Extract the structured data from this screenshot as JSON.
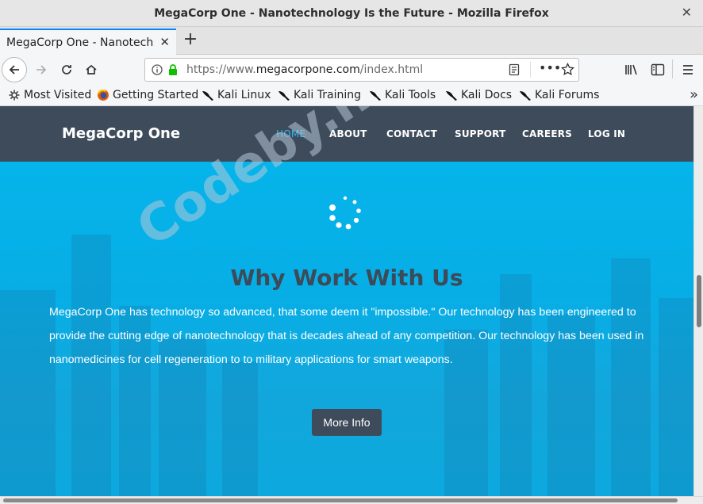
{
  "window": {
    "title": "MegaCorp One - Nanotechnology Is the Future - Mozilla Firefox"
  },
  "tabs": [
    {
      "label": "MegaCorp One - Nanotechnology Is the Future"
    }
  ],
  "urlbar": {
    "prefix": "https://www.",
    "domain": "megacorpone.com",
    "path": "/index.html"
  },
  "bookmarks": [
    {
      "label": "Most Visited",
      "icon": "gear-icon"
    },
    {
      "label": "Getting Started",
      "icon": "firefox-icon"
    },
    {
      "label": "Kali Linux",
      "icon": "kali-dragon-icon"
    },
    {
      "label": "Kali Training",
      "icon": "kali-dragon-icon"
    },
    {
      "label": "Kali Tools",
      "icon": "kali-dragon-icon"
    },
    {
      "label": "Kali Docs",
      "icon": "kali-dragon-icon"
    },
    {
      "label": "Kali Forums",
      "icon": "kali-dragon-icon"
    }
  ],
  "site": {
    "brand": "MegaCorp One",
    "menu": [
      "HOME",
      "ABOUT",
      "CONTACT",
      "SUPPORT",
      "CAREERS",
      "LOG IN"
    ],
    "active_menu": "HOME",
    "hero_title": "Why Work With Us",
    "hero_text": "MegaCorp One has technology so advanced, that some deem it \"impossible.\" Our technology has been engineered to provide the cutting edge of nanotechnology that is decades ahead of any competition. Our technology has been used in nanomedicines for cell regeneration to to military applications for smart weapons.",
    "button": "More Info"
  },
  "watermark": "Codeby.net",
  "colors": {
    "header_bg": "#3e4b5b",
    "hero_bg": "#06b6ec",
    "active_menu": "#2eb9f0",
    "tab_accent": "#0a84ff"
  }
}
